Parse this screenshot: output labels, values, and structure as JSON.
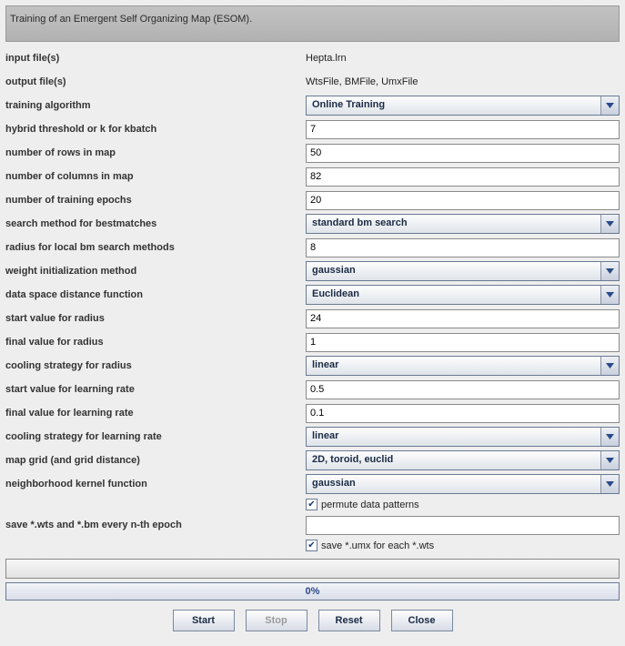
{
  "header": {
    "title": "Training of an Emergent Self Organizing Map (ESOM)."
  },
  "static": {
    "input_files_label": "input file(s)",
    "input_files_value": "Hepta.lrn",
    "output_files_label": "output file(s)",
    "output_files_value": "WtsFile, BMFile, UmxFile"
  },
  "fields": {
    "training_algo": {
      "label": "training algorithm",
      "value": "Online Training",
      "type": "select"
    },
    "hybrid_k": {
      "label": "hybrid threshold or k for kbatch",
      "value": "7",
      "type": "text"
    },
    "rows": {
      "label": "number of rows in map",
      "value": "50",
      "type": "text"
    },
    "cols": {
      "label": "number of columns in map",
      "value": "82",
      "type": "text"
    },
    "epochs": {
      "label": "number of training epochs",
      "value": "20",
      "type": "text"
    },
    "search_method": {
      "label": "search method for bestmatches",
      "value": "standard bm search",
      "type": "select"
    },
    "radius_local": {
      "label": "radius for local bm search methods",
      "value": "8",
      "type": "text"
    },
    "weight_init": {
      "label": "weight initialization method",
      "value": "gaussian",
      "type": "select"
    },
    "dist_func": {
      "label": "data space distance function",
      "value": "Euclidean",
      "type": "select"
    },
    "radius_start": {
      "label": "start value for radius",
      "value": "24",
      "type": "text"
    },
    "radius_final": {
      "label": "final value for radius",
      "value": "1",
      "type": "text"
    },
    "cool_radius": {
      "label": "cooling strategy for radius",
      "value": "linear",
      "type": "select"
    },
    "lr_start": {
      "label": "start value for learning rate",
      "value": "0.5",
      "type": "text"
    },
    "lr_final": {
      "label": "final value for learning rate",
      "value": "0.1",
      "type": "text"
    },
    "cool_lr": {
      "label": "cooling strategy for learning rate",
      "value": "linear",
      "type": "select"
    },
    "map_grid": {
      "label": "map grid (and grid distance)",
      "value": "2D, toroid, euclid",
      "type": "select"
    },
    "neigh_kernel": {
      "label": "neighborhood kernel function",
      "value": "gaussian",
      "type": "select"
    },
    "save_every": {
      "label": "save *.wts and *.bm every n-th epoch",
      "value": "",
      "type": "text"
    }
  },
  "checkboxes": {
    "permute": {
      "label": "permute data patterns",
      "checked": true
    },
    "save_umx": {
      "label": "save *.umx for each *.wts",
      "checked": true
    }
  },
  "progress": {
    "percent_label": "0%"
  },
  "buttons": {
    "start": "Start",
    "stop": "Stop",
    "reset": "Reset",
    "close": "Close"
  }
}
